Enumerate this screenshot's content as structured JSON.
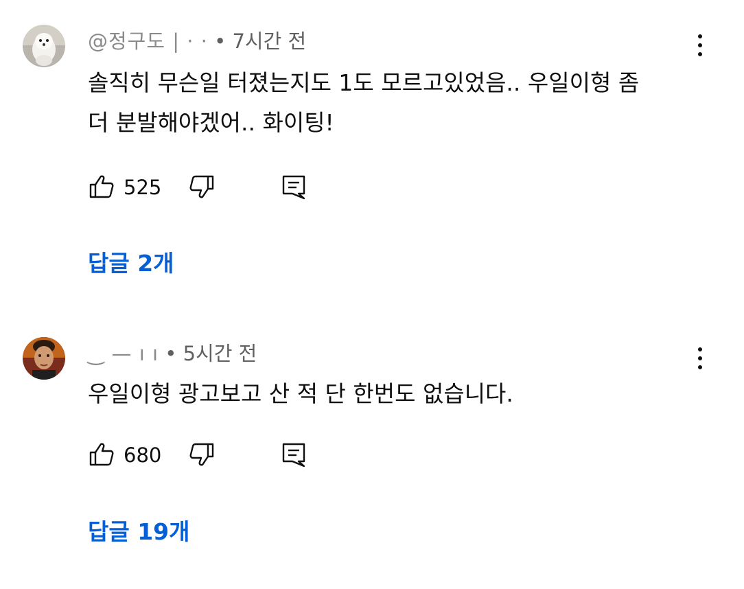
{
  "comments": [
    {
      "handle": "@정구도 | ·  ·",
      "time": "• 7시간 전",
      "text_line1": "솔직히 무슨일 터졌는지도 1도 모르고있었음.. 우일이형 좀",
      "text_line2": "더 분발해야겠어.. 화이팅!",
      "likes": "525",
      "replies": "답글 2개",
      "avatar_icon": "white-dog-avatar"
    },
    {
      "handle": "‿ — ı ı",
      "time": "• 5시간 전",
      "text_line1": "우일이형 광고보고 산 적 단 한번도 없습니다.",
      "likes": "680",
      "replies": "답글 19개",
      "avatar_icon": "person-avatar"
    }
  ],
  "icons": {
    "like": "thumbs-up-icon",
    "dislike": "thumbs-down-icon",
    "reply": "reply-icon",
    "more": "more-vert-icon"
  },
  "colors": {
    "link": "#065fd4",
    "meta": "#606060",
    "text": "#0f0f0f"
  }
}
